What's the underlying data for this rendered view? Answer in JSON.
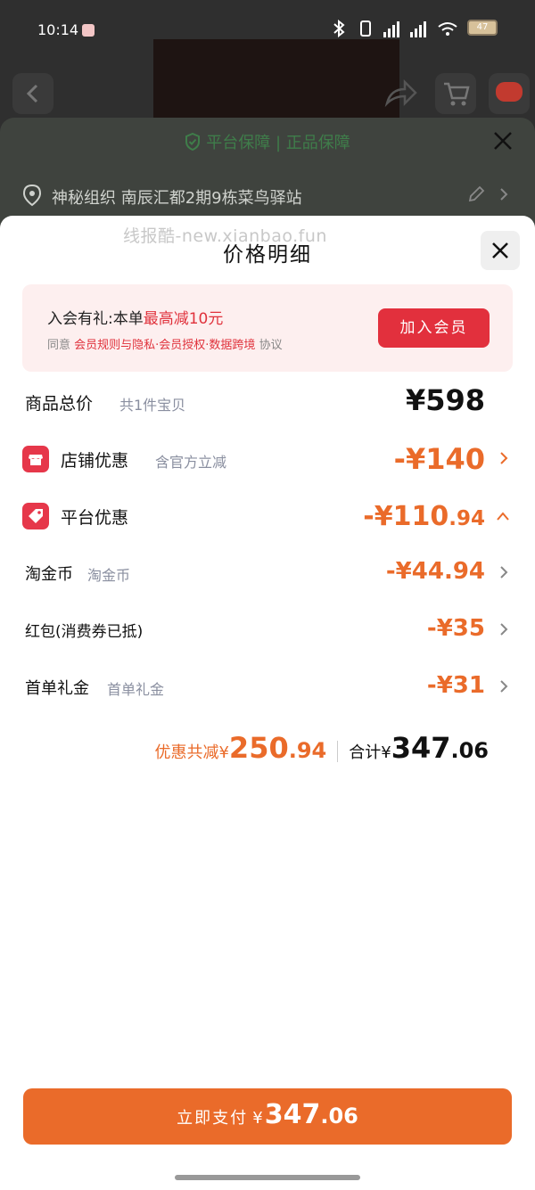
{
  "status_bar": {
    "time": "10:14",
    "battery": "47"
  },
  "background": {
    "guarantee_text": "平台保障 | 正品保障",
    "address": "神秘组织 南辰汇都2期9栋菜鸟驿站"
  },
  "watermark": "线报酷-new.xianbao.fun",
  "sheet": {
    "title": "价格明细"
  },
  "member": {
    "line1_prefix": "入会有礼:本单",
    "line1_highlight": "最高减10元",
    "line2_prefix": "同意",
    "line2_highlight": "会员规则与隐私·会员授权·数据跨境",
    "line2_suffix": "协议",
    "join_label": "加入会员"
  },
  "rows": {
    "total": {
      "label": "商品总价",
      "sub": "共1件宝贝",
      "amount": "¥598"
    },
    "shop": {
      "label": "店铺优惠",
      "sub": "含官方立减",
      "amount": "-¥140"
    },
    "platform": {
      "label": "平台优惠",
      "amount_main": "-¥110",
      "amount_dec": ".94"
    },
    "coin": {
      "label": "淘金币",
      "sub": "淘金币",
      "amount": "-¥44.94"
    },
    "redpack": {
      "label": "红包(消费券已抵)",
      "amount": "-¥35"
    },
    "first": {
      "label": "首单礼金",
      "sub": "首单礼金",
      "amount": "-¥31"
    }
  },
  "summary": {
    "discount_label": "优惠共减¥",
    "discount_main": "250",
    "discount_dec": ".94",
    "total_label": "合计¥",
    "total_main": "347",
    "total_dec": ".06"
  },
  "pay": {
    "label": "立即支付",
    "currency": "¥",
    "main": "347",
    "dec": ".06"
  },
  "colors": {
    "accent": "#ea6b2a",
    "red": "#e2303d",
    "member_bg": "#fdefef"
  }
}
